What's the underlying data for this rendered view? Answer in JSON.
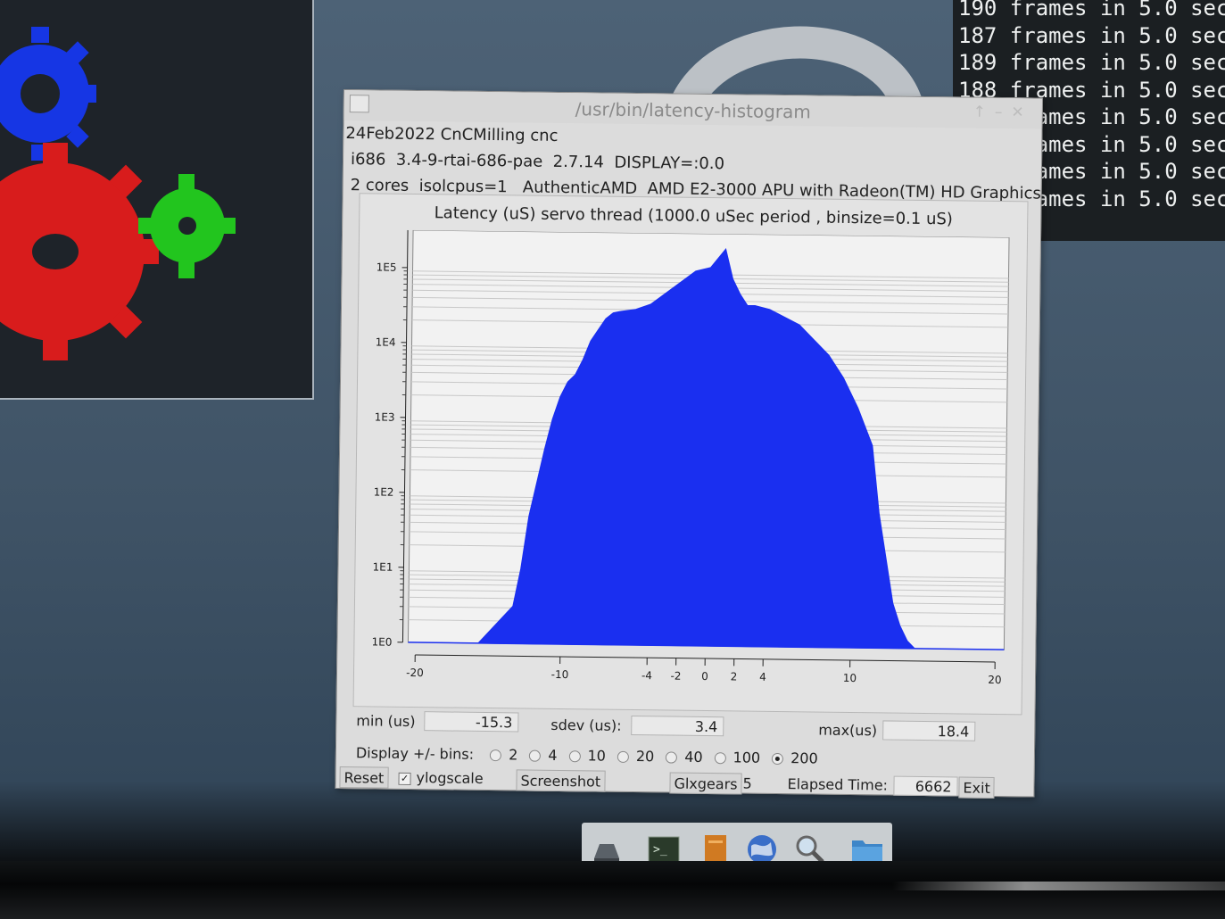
{
  "histogram_window": {
    "title": "/usr/bin/latency-histogram",
    "info_line1": "24Feb2022 CnCMilling cnc",
    "info_line2": "i686  3.4-9-rtai-686-pae  2.7.14  DISPLAY=:0.0",
    "info_line3": "2 cores  isolcpus=1   AuthenticAMD  AMD E2-3000 APU with Radeon(TM) HD Graphics",
    "stats": {
      "min_label": "min (us)",
      "min_value": "-15.3",
      "sdev_label": "sdev (us):",
      "sdev_value": "3.4",
      "max_label": "max(us)",
      "max_value": "18.4"
    },
    "display_bins_label": "Display +/- bins:",
    "bins_options": [
      "2",
      "4",
      "10",
      "20",
      "40",
      "100",
      "200"
    ],
    "bins_selected": "200",
    "reset_label": "Reset",
    "ylogscale_label": "ylogscale",
    "ylogscale_checked": true,
    "screenshot_label": "Screenshot",
    "glxgears_label": "Glxgears",
    "glxgears_value": "5",
    "elapsed_label": "Elapsed Time:",
    "elapsed_value": "6662",
    "exit_label": "Exit"
  },
  "terminal": {
    "lines": [
      "190 frames in 5.0 sec",
      "187 frames in 5.0 sec",
      "189 frames in 5.0 sec",
      "188 frames in 5.0 sec",
      "188 frames in 5.0 sec",
      "188 frames in 5.0 sec",
      "188 frames in 5.0 sec",
      "188 frames in 5.0 sec"
    ]
  },
  "chart_data": {
    "type": "area",
    "title": "Latency (uS) servo thread (1000.0 uSec period , binsize=0.1 uS)",
    "xlabel": "",
    "ylabel": "",
    "xlim": [
      -20,
      20
    ],
    "ylim_log10": [
      0,
      5.5
    ],
    "log_scale_y": true,
    "x_ticks": [
      "-20",
      "-10",
      "-4",
      "-2",
      "0",
      "2",
      "4",
      "10",
      "20"
    ],
    "x_tick_values": [
      -20,
      -10,
      -4,
      -2,
      0,
      2,
      4,
      10,
      20
    ],
    "y_ticks": [
      "1E0",
      "1E1",
      "1E2",
      "1E3",
      "1E4",
      "1E5"
    ],
    "y_tick_values": [
      1,
      10,
      100,
      1000,
      10000,
      100000
    ],
    "series": [
      {
        "color": "#1a2ff0",
        "x": [
          -15.3,
          -13,
          -12.5,
          -12,
          -11,
          -10.5,
          -10,
          -9.5,
          -9,
          -8.5,
          -8,
          -7.5,
          -7,
          -6.5,
          -6,
          -5,
          -4,
          -3,
          -2,
          -1,
          0,
          1,
          1.5,
          2,
          2.5,
          3,
          4,
          5,
          6,
          7,
          8,
          9,
          10,
          11,
          11.5,
          12,
          12.5,
          13,
          13.5,
          14
        ],
        "log10_counts": [
          0,
          0.5,
          1.0,
          1.7,
          2.6,
          3.0,
          3.3,
          3.5,
          3.6,
          3.8,
          4.05,
          4.2,
          4.35,
          4.43,
          4.45,
          4.48,
          4.55,
          4.7,
          4.85,
          5.0,
          5.05,
          5.3,
          4.9,
          4.7,
          4.55,
          4.55,
          4.5,
          4.4,
          4.3,
          4.1,
          3.9,
          3.6,
          3.2,
          2.7,
          1.8,
          1.2,
          0.6,
          0.3,
          0.1,
          0
        ]
      }
    ]
  }
}
